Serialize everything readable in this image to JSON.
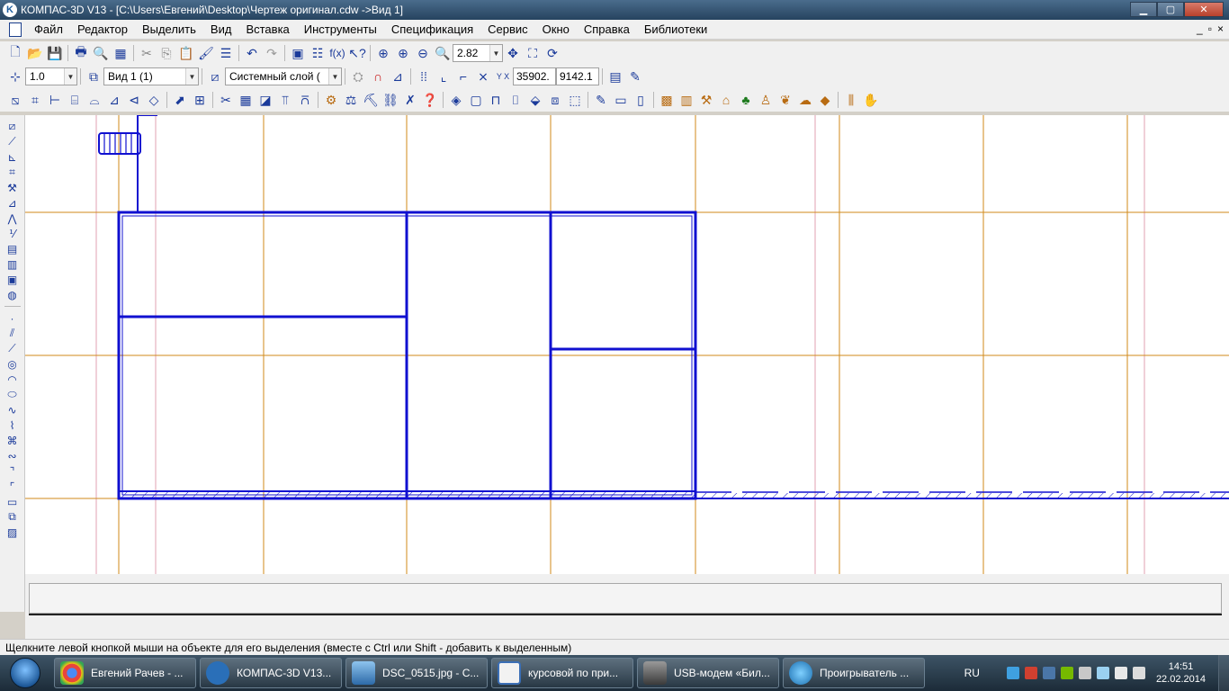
{
  "window": {
    "title": "КОМПАС-3D V13 - [C:\\Users\\Евгений\\Desktop\\Чертеж оригинал.cdw ->Вид 1]",
    "app_icon": "kompas-logo-icon",
    "controls": [
      "minimize-icon",
      "maximize-icon",
      "close-icon"
    ]
  },
  "menubar": {
    "items": [
      "Файл",
      "Редактор",
      "Выделить",
      "Вид",
      "Вставка",
      "Инструменты",
      "Спецификация",
      "Сервис",
      "Окно",
      "Справка",
      "Библиотеки"
    ],
    "mdi_controls": [
      "_",
      "▫",
      "×"
    ]
  },
  "toolbar1": {
    "zoom_value": "2.82"
  },
  "toolbar2": {
    "scale_value": "1.0",
    "view_value": "Вид 1 (1)",
    "layer_value": "Системный слой (",
    "coord_x": "35902.",
    "coord_y": "9142.1"
  },
  "propzone": {},
  "statusbar": {
    "message": "Щелкните левой кнопкой мыши на объекте для его выделения (вместе с Ctrl или Shift - добавить к выделенным)"
  },
  "taskbar": {
    "buttons": [
      {
        "label": "Евгений Рачев - ...",
        "icon": "chrome-icon",
        "color": "#e8453c"
      },
      {
        "label": "КОМПАС-3D V13...",
        "icon": "kompas-icon",
        "color": "#2a6fb8"
      },
      {
        "label": "DSC_0515.jpg - С...",
        "icon": "image-viewer-icon",
        "color": "#4a86c8"
      },
      {
        "label": "курсовой по при...",
        "icon": "word-icon",
        "color": "#3b6fb6"
      },
      {
        "label": "USB-модем «Бил...",
        "icon": "modem-icon",
        "color": "#5a5a5a"
      },
      {
        "label": "Проигрыватель ...",
        "icon": "media-player-icon",
        "color": "#2f8ac8"
      }
    ],
    "tray": {
      "language": "RU",
      "time": "14:51",
      "date": "22.02.2014"
    }
  },
  "colors": {
    "drawing_line": "#1010d0",
    "axis_line": "#d08a1a",
    "grid_line": "#e0a0b0"
  }
}
